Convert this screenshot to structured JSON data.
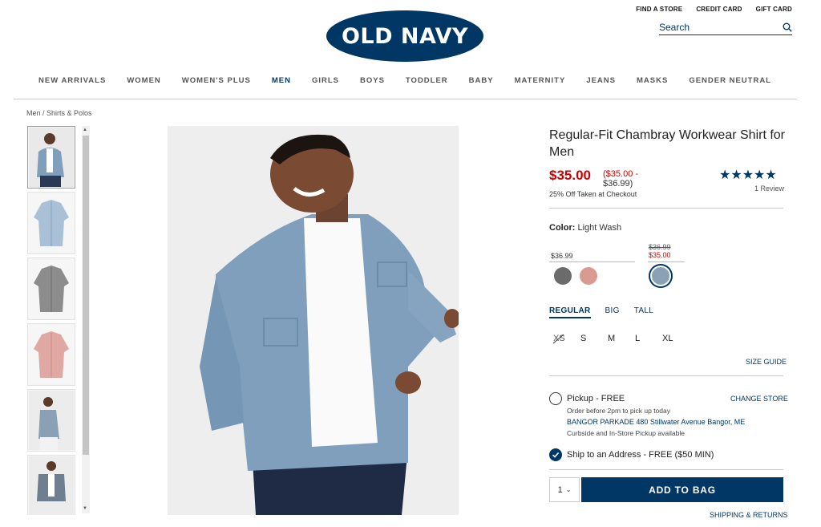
{
  "brand": {
    "logo_text": "OLD NAVY",
    "color": "#003764"
  },
  "utility_links": [
    "FIND A STORE",
    "CREDIT CARD",
    "GIFT CARD"
  ],
  "search": {
    "placeholder": "Search"
  },
  "nav": {
    "items": [
      "NEW ARRIVALS",
      "WOMEN",
      "WOMEN'S PLUS",
      "MEN",
      "GIRLS",
      "BOYS",
      "TODDLER",
      "BABY",
      "MATERNITY",
      "JEANS",
      "MASKS",
      "GENDER NEUTRAL"
    ],
    "active": "MEN"
  },
  "breadcrumb": "Men / Shirts & Polos",
  "product": {
    "title": "Regular-Fit Chambray Workwear Shirt for Men",
    "price": "$35.00",
    "price_range_line1": "($35.00 -",
    "price_range_line2": "$36.99)",
    "promo": "25% Off Taken at Checkout",
    "rating_stars": "★★★★★",
    "reviews": "1 Review",
    "color_label": "Color:",
    "color_value": "Light Wash",
    "swatch_group1_price": "$36.99",
    "swatch_group2_old_price": "$36.99",
    "swatch_group2_new_price": "$35.00",
    "swatches": [
      {
        "name": "charcoal",
        "color": "#6b6b6b"
      },
      {
        "name": "pink",
        "color": "#d99a92"
      },
      {
        "name": "light-wash",
        "color": "#8aa0b4"
      }
    ],
    "fit_tabs": [
      "REGULAR",
      "BIG",
      "TALL"
    ],
    "sizes": [
      "XS",
      "S",
      "M",
      "L",
      "XL"
    ],
    "size_guide": "SIZE GUIDE",
    "pickup_label": "Pickup - FREE",
    "change_store": "CHANGE STORE",
    "pickup_note": "Order before 2pm to pick up today",
    "store_line": "BANGOR PARKADE 480 Stillwater Avenue  Bangor, ME",
    "curbside": "Curbside and In-Store Pickup available",
    "ship_label": "Ship to an Address - FREE ($50 MIN)",
    "quantity": "1",
    "add_to_bag": "ADD TO BAG",
    "shipping_returns": "SHIPPING & RETURNS"
  }
}
